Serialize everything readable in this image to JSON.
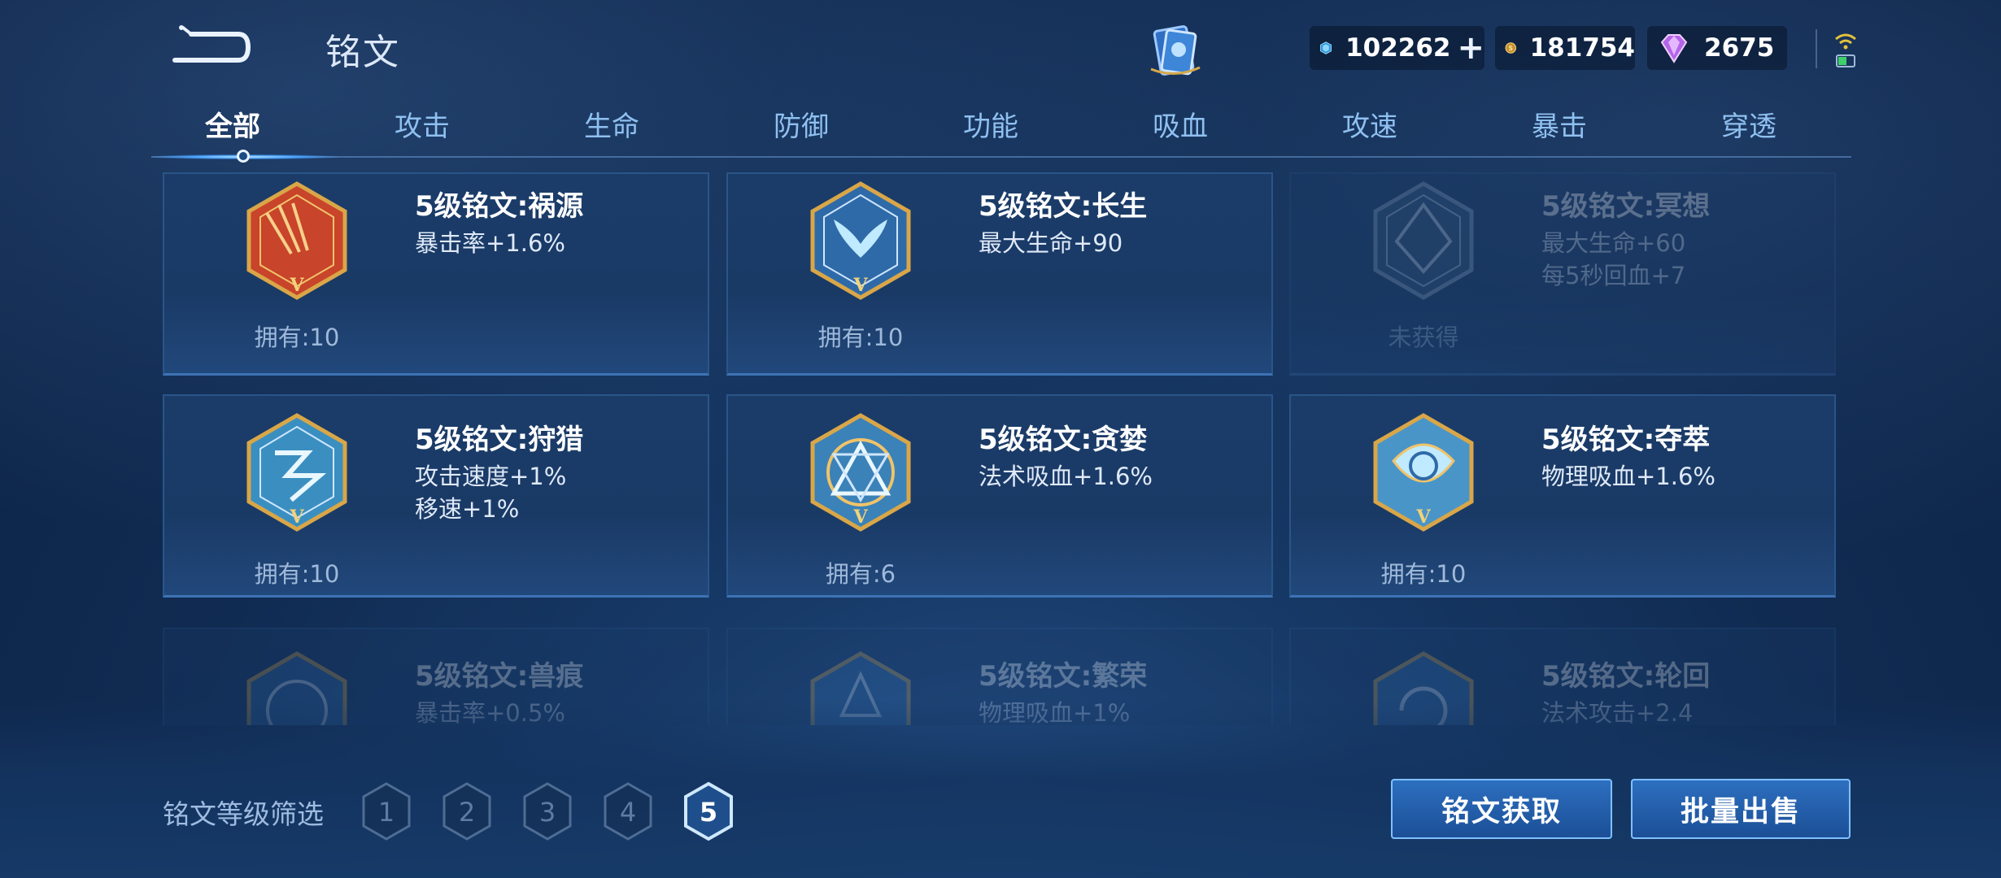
{
  "header": {
    "title": "铭文",
    "currencies": [
      {
        "icon": "diamond-icon",
        "value": "102262"
      },
      {
        "icon": "gold-coin-icon",
        "value": "181754"
      },
      {
        "icon": "gem-icon",
        "value": "2675"
      }
    ],
    "plus_label": "+"
  },
  "tabs": [
    "全部",
    "攻击",
    "生命",
    "防御",
    "功能",
    "吸血",
    "攻速",
    "暴击",
    "穿透"
  ],
  "active_tab": 0,
  "cards": [
    {
      "name": "5级铭文:祸源",
      "stats": [
        "暴击率+1.6%"
      ],
      "owned": "拥有:10",
      "color": "#c8442a",
      "state": "owned",
      "icon": "crit-rune-icon"
    },
    {
      "name": "5级铭文:长生",
      "stats": [
        "最大生命+90"
      ],
      "owned": "拥有:10",
      "color": "#2f6aa8",
      "state": "owned",
      "icon": "life-rune-icon"
    },
    {
      "name": "5级铭文:冥想",
      "stats": [
        "最大生命+60",
        "每5秒回血+7"
      ],
      "owned": "未获得",
      "color": "#35587f",
      "state": "locked",
      "icon": "meditation-rune-icon"
    },
    {
      "name": "5级铭文:狩猎",
      "stats": [
        "攻击速度+1%",
        "移速+1%"
      ],
      "owned": "拥有:10",
      "color": "#3a8fc0",
      "state": "owned",
      "icon": "hunt-rune-icon"
    },
    {
      "name": "5级铭文:贪婪",
      "stats": [
        "法术吸血+1.6%"
      ],
      "owned": "拥有:6",
      "color": "#3b82b8",
      "state": "owned",
      "icon": "greed-rune-icon"
    },
    {
      "name": "5级铭文:夺萃",
      "stats": [
        "物理吸血+1.6%"
      ],
      "owned": "拥有:10",
      "color": "#4a95c8",
      "state": "owned",
      "icon": "plunder-rune-icon"
    },
    {
      "name": "5级铭文:兽痕",
      "stats": [
        "暴击率+0.5%"
      ],
      "owned": "",
      "color": "#2f6aa8",
      "state": "faded",
      "icon": "beast-rune-icon"
    },
    {
      "name": "5级铭文:繁荣",
      "stats": [
        "物理吸血+1%"
      ],
      "owned": "",
      "color": "#2f6aa8",
      "state": "faded",
      "icon": "prosperity-rune-icon"
    },
    {
      "name": "5级铭文:轮回",
      "stats": [
        "法术攻击+2.4"
      ],
      "owned": "",
      "color": "#2f6aa8",
      "state": "faded",
      "icon": "cycle-rune-icon"
    }
  ],
  "footer": {
    "filter_label": "铭文等级筛选",
    "levels": [
      "1",
      "2",
      "3",
      "4",
      "5"
    ],
    "selected_level": "5",
    "buttons": {
      "acquire": "铭文获取",
      "bulk_sell": "批量出售"
    }
  },
  "colors": {
    "accent": "#7fc0ff",
    "gold": "#c8a040",
    "panel": "#1b3c69"
  }
}
